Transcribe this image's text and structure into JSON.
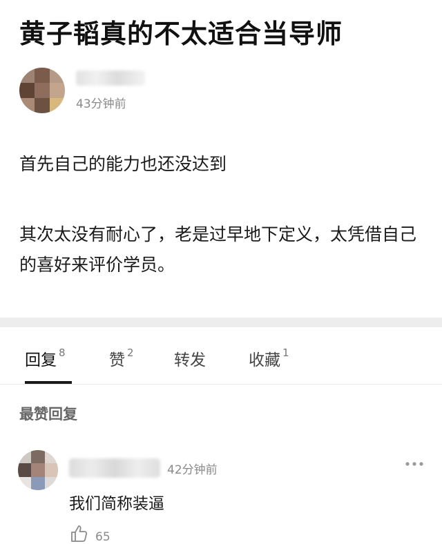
{
  "post": {
    "title": "黄子韬真的不太适合当导师",
    "author": {
      "time": "43分钟前"
    },
    "paragraphs": [
      "首先自己的能力也还没达到",
      "其次太没有耐心了，老是过早地下定义，太凭借自己的喜好来评价学员。"
    ]
  },
  "tabs": [
    {
      "label": "回复",
      "count": "8"
    },
    {
      "label": "赞",
      "count": "2"
    },
    {
      "label": "转发",
      "count": ""
    },
    {
      "label": "收藏",
      "count": "1"
    }
  ],
  "comments_section": {
    "label": "最赞回复"
  },
  "comment": {
    "time": "42分钟前",
    "text": "我们简称装逼",
    "likes": "65"
  },
  "icons": {
    "more": "more-dots-icon",
    "like": "thumbs-up-icon"
  }
}
